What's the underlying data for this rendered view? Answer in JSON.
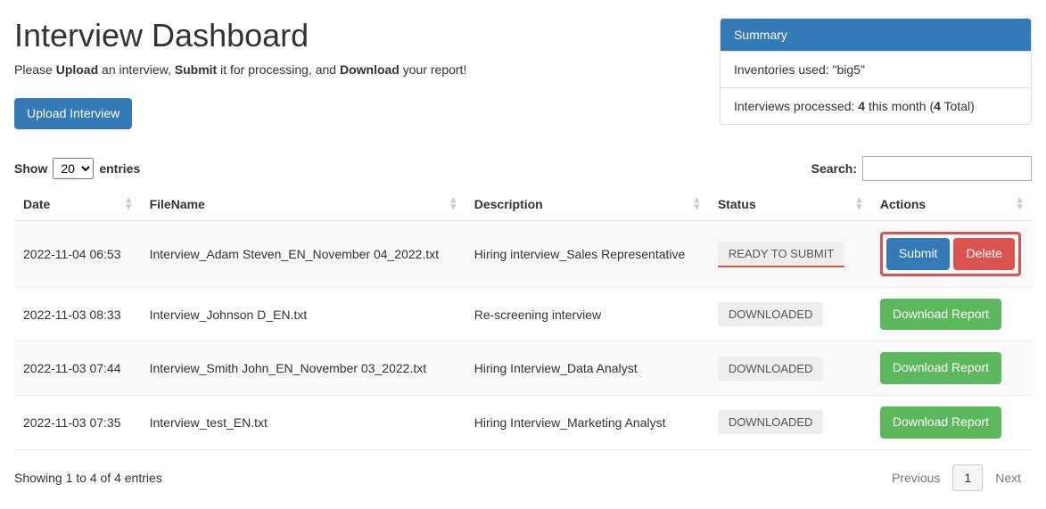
{
  "header": {
    "title": "Interview Dashboard",
    "subtitle_parts": {
      "p1": "Please ",
      "b1": "Upload",
      "p2": " an interview, ",
      "b2": "Submit",
      "p3": " it for processing, and ",
      "b3": "Download",
      "p4": " your report!"
    },
    "upload_button": "Upload Interview"
  },
  "summary": {
    "header": "Summary",
    "inventories_line": "Inventories used: \"big5\"",
    "interviews_prefix": "Interviews processed: ",
    "interviews_month_count": "4",
    "interviews_middle": " this month (",
    "interviews_total_count": "4",
    "interviews_suffix": " Total)"
  },
  "controls": {
    "show_label": "Show",
    "show_value": "20",
    "entries_label": "entries",
    "search_label": "Search:"
  },
  "columns": {
    "date": "Date",
    "filename": "FileName",
    "description": "Description",
    "status": "Status",
    "actions": "Actions"
  },
  "rows": [
    {
      "date": "2022-11-04 06:53",
      "filename": "Interview_Adam Steven_EN_November 04_2022.txt",
      "description": "Hiring interview_Sales Representative",
      "status": "READY TO SUBMIT",
      "status_kind": "ready",
      "action_kind": "submit_delete"
    },
    {
      "date": "2022-11-03 08:33",
      "filename": "Interview_Johnson D_EN.txt",
      "description": "Re-screening interview",
      "status": "DOWNLOADED",
      "status_kind": "downloaded",
      "action_kind": "download"
    },
    {
      "date": "2022-11-03 07:44",
      "filename": "Interview_Smith John_EN_November 03_2022.txt",
      "description": "Hiring Interview_Data Analyst",
      "status": "DOWNLOADED",
      "status_kind": "downloaded",
      "action_kind": "download"
    },
    {
      "date": "2022-11-03 07:35",
      "filename": "Interview_test_EN.txt",
      "description": "Hiring Interview_Marketing Analyst",
      "status": "DOWNLOADED",
      "status_kind": "downloaded",
      "action_kind": "download"
    }
  ],
  "buttons": {
    "submit": "Submit",
    "delete": "Delete",
    "download_report": "Download Report"
  },
  "footer": {
    "showing_text": "Showing 1 to 4 of 4 entries",
    "previous": "Previous",
    "current_page": "1",
    "next": "Next"
  }
}
